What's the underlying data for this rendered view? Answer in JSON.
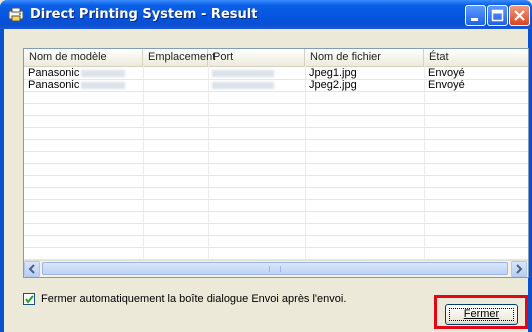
{
  "window": {
    "title": "Direct Printing System - Result",
    "title_bar_color": "#0a5fe6",
    "controls": [
      "minimize-icon",
      "maximize-icon",
      "close-icon"
    ]
  },
  "list": {
    "columns": [
      "Nom de modèle",
      "Emplacement",
      "Port",
      "Nom de fichier",
      "État"
    ],
    "rows": [
      {
        "model": "Panasonic",
        "location": "",
        "file": "Jpeg1.jpg",
        "status": "Envoyé"
      },
      {
        "model": "Panasonic",
        "location": "",
        "file": "Jpeg2.jpg",
        "status": "Envoyé"
      }
    ]
  },
  "options": {
    "auto_close_label": "Fermer automatiquement la boîte dialogue Envoi après l'envoi.",
    "auto_close_checked": true
  },
  "buttons": {
    "close_label": "Fermer"
  },
  "highlight_color": "#e30613"
}
